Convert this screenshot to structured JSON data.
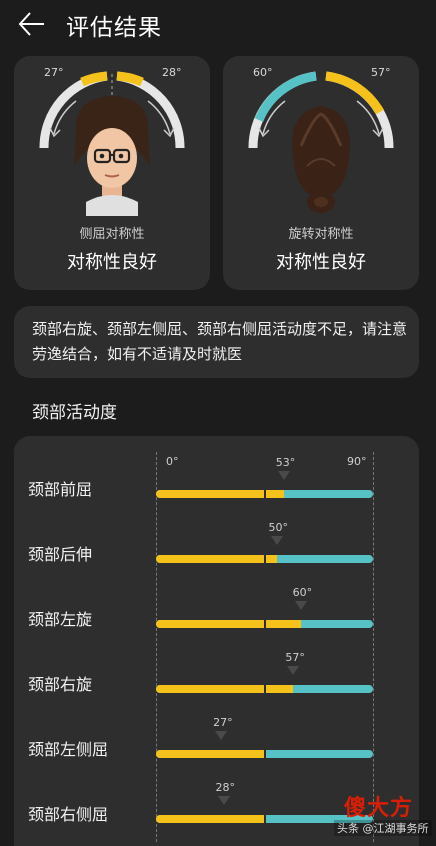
{
  "header": {
    "title": "评估结果"
  },
  "symmetry": [
    {
      "left_deg": "27°",
      "right_deg": "28°",
      "label": "侧屈对称性",
      "result": "对称性良好"
    },
    {
      "left_deg": "60°",
      "right_deg": "57°",
      "label": "旋转对称性",
      "result": "对称性良好"
    }
  ],
  "advice": "颈部右旋、颈部左侧屈、颈部右侧屈活动度不足，请注意劳逸结合，如有不适请及时就医",
  "rom": {
    "title": "颈部活动度",
    "axis": {
      "min_label": "0°",
      "max_label": "90°",
      "max": 90,
      "normal": 45
    },
    "rows": [
      {
        "label": "颈部前屈",
        "value": 53,
        "value_label": "53°"
      },
      {
        "label": "颈部后伸",
        "value": 50,
        "value_label": "50°"
      },
      {
        "label": "颈部左旋",
        "value": 60,
        "value_label": "60°"
      },
      {
        "label": "颈部右旋",
        "value": 57,
        "value_label": "57°"
      },
      {
        "label": "颈部左侧屈",
        "value": 27,
        "value_label": "27°"
      },
      {
        "label": "颈部右侧屈",
        "value": 28,
        "value_label": "28°"
      }
    ]
  },
  "colors": {
    "accent_yellow": "#f5c21b",
    "accent_teal": "#56c2c6",
    "card": "#2e2e2e",
    "background": "#1c1c1c"
  },
  "watermark": {
    "logo": "傻大方",
    "source": "头条 @江湖事务所"
  }
}
